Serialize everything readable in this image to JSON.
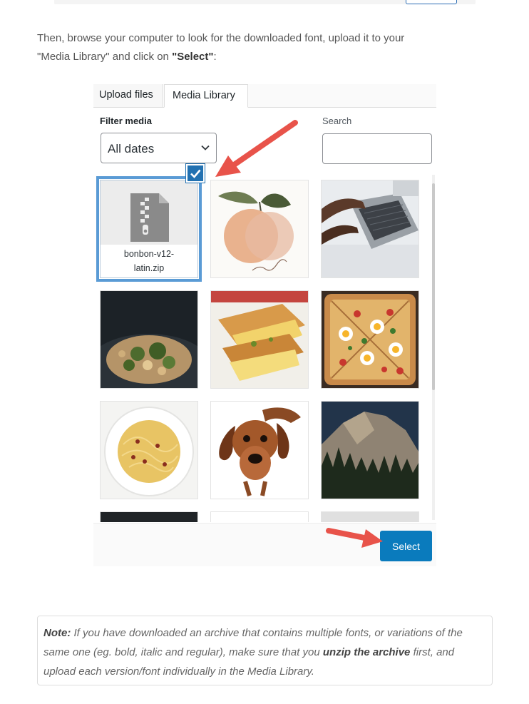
{
  "intro": {
    "line1": "Then, browse your computer to look for the downloaded font, upload it to your",
    "line2_prefix": "\"Media Library\" and click on ",
    "line2_bold": "\"Select\"",
    "line2_suffix": ":"
  },
  "modal": {
    "tabs": [
      {
        "label": "Upload files"
      },
      {
        "label": "Media Library",
        "active": true
      }
    ],
    "filter": {
      "label": "Filter media",
      "selected": "All dates"
    },
    "search": {
      "label": "Search",
      "value": "",
      "placeholder": ""
    },
    "selected_file": {
      "name_line1": "bonbon-v12-",
      "name_line2": "latin.zip"
    },
    "tiles": [
      {
        "icon": "zip-file-icon"
      },
      {
        "icon": "peach-illustration"
      },
      {
        "icon": "laptop-typing-photo"
      },
      {
        "icon": "broccoli-pasta-photo"
      },
      {
        "icon": "grilled-cheese-photo"
      },
      {
        "icon": "egg-pizza-photo"
      },
      {
        "icon": "spaghetti-photo"
      },
      {
        "icon": "dachshund-photo"
      },
      {
        "icon": "mountain-forest-photo"
      }
    ],
    "select_button": "Select"
  },
  "note": {
    "label": "Note:",
    "text1": " If you have downloaded an archive that contains multiple fonts, or variations of the same one (eg. bold, italic and regular), make sure that you ",
    "bold": "unzip the archive",
    "text2": " first, and upload each version/font individually in the Media Library."
  },
  "colors": {
    "accent": "#2271b1",
    "button": "#0a7bbd",
    "arrow": "#e8534a",
    "selection": "#5a9bd5"
  }
}
